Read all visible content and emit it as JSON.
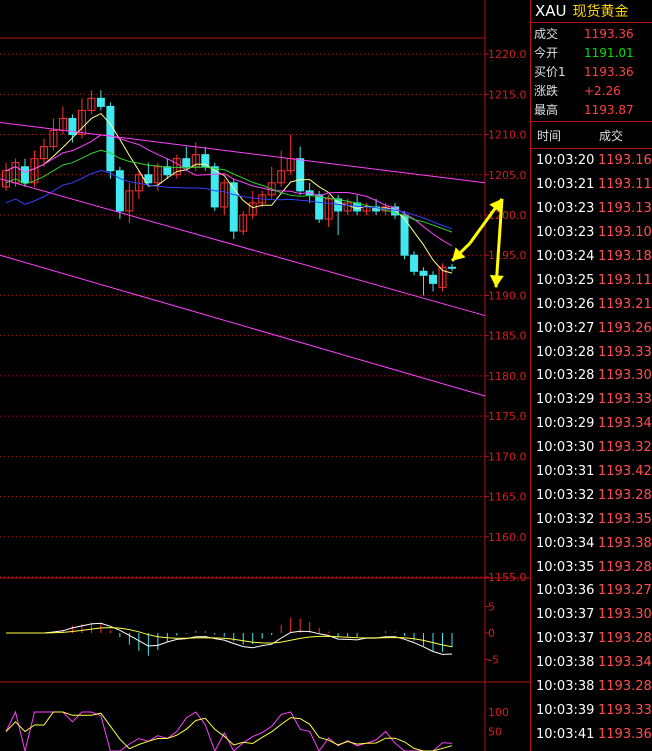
{
  "header": {
    "symbol": "XAU",
    "name": "现货黄金"
  },
  "quote": [
    {
      "label": "成交",
      "value": "1193.36",
      "color": "red"
    },
    {
      "label": "今开",
      "value": "1191.01",
      "color": "green"
    },
    {
      "label": "买价1",
      "value": "1193.36",
      "color": "red"
    },
    {
      "label": "涨跌",
      "value": "+2.26",
      "color": "red"
    },
    {
      "label": "最高",
      "value": "1193.87",
      "color": "red"
    }
  ],
  "ticks_header": {
    "time": "时间",
    "price": "成交"
  },
  "ticks": [
    {
      "time": "10:03:20",
      "price": "1193.16"
    },
    {
      "time": "10:03:21",
      "price": "1193.11"
    },
    {
      "time": "10:03:23",
      "price": "1193.13"
    },
    {
      "time": "10:03:23",
      "price": "1193.10"
    },
    {
      "time": "10:03:24",
      "price": "1193.18"
    },
    {
      "time": "10:03:25",
      "price": "1193.11"
    },
    {
      "time": "10:03:26",
      "price": "1193.21"
    },
    {
      "time": "10:03:27",
      "price": "1193.26"
    },
    {
      "time": "10:03:28",
      "price": "1193.33"
    },
    {
      "time": "10:03:28",
      "price": "1193.30"
    },
    {
      "time": "10:03:29",
      "price": "1193.33"
    },
    {
      "time": "10:03:29",
      "price": "1193.34"
    },
    {
      "time": "10:03:30",
      "price": "1193.32"
    },
    {
      "time": "10:03:31",
      "price": "1193.42"
    },
    {
      "time": "10:03:32",
      "price": "1193.28"
    },
    {
      "time": "10:03:32",
      "price": "1193.35"
    },
    {
      "time": "10:03:34",
      "price": "1193.38"
    },
    {
      "time": "10:03:35",
      "price": "1193.28"
    },
    {
      "time": "10:03:36",
      "price": "1193.27"
    },
    {
      "time": "10:03:37",
      "price": "1193.30"
    },
    {
      "time": "10:03:37",
      "price": "1193.28"
    },
    {
      "time": "10:03:38",
      "price": "1193.34"
    },
    {
      "time": "10:03:38",
      "price": "1193.28"
    },
    {
      "time": "10:03:39",
      "price": "1193.33"
    },
    {
      "time": "10:03:41",
      "price": "1193.36"
    }
  ],
  "chart_data": {
    "type": "candlestick",
    "y_ticks": [
      "1220.0",
      "1215.0",
      "1210.0",
      "1205.0",
      "1200.0",
      "1195.0",
      "1190.0",
      "1185.0",
      "1180.0",
      "1175.0",
      "1170.0",
      "1165.0",
      "1160.0",
      "1155.0"
    ],
    "ylim": [
      1155,
      1222
    ],
    "macd_ticks": [
      "5",
      "0",
      "-5"
    ],
    "kdj_ticks": [
      "100",
      "50"
    ],
    "colors": {
      "up": "#ff3030",
      "down": "#40e8f0",
      "grid": "#b41414",
      "ma5": "#ffff88",
      "ma10": "#ff40ff",
      "ma20": "#30d030",
      "ma60": "#3040ff",
      "channel": "#ff40ff",
      "arrow": "#ffff00"
    },
    "candles": [
      {
        "o": 1203.5,
        "c": 1205.5,
        "h": 1206.5,
        "l": 1203.0
      },
      {
        "o": 1204.0,
        "c": 1206.5,
        "h": 1207.0,
        "l": 1203.5
      },
      {
        "o": 1206.0,
        "c": 1204.0,
        "h": 1207.0,
        "l": 1203.5
      },
      {
        "o": 1204.0,
        "c": 1207.0,
        "h": 1208.0,
        "l": 1203.5
      },
      {
        "o": 1207.0,
        "c": 1208.5,
        "h": 1209.5,
        "l": 1206.0
      },
      {
        "o": 1208.5,
        "c": 1210.5,
        "h": 1212.0,
        "l": 1208.0
      },
      {
        "o": 1210.5,
        "c": 1212.0,
        "h": 1213.5,
        "l": 1210.0
      },
      {
        "o": 1212.0,
        "c": 1210.0,
        "h": 1212.5,
        "l": 1209.0
      },
      {
        "o": 1210.0,
        "c": 1213.0,
        "h": 1214.5,
        "l": 1209.5
      },
      {
        "o": 1213.0,
        "c": 1214.5,
        "h": 1215.5,
        "l": 1212.5
      },
      {
        "o": 1214.5,
        "c": 1213.5,
        "h": 1215.5,
        "l": 1213.0
      },
      {
        "o": 1213.5,
        "c": 1205.5,
        "h": 1214.0,
        "l": 1204.5
      },
      {
        "o": 1205.5,
        "c": 1200.5,
        "h": 1206.0,
        "l": 1199.5
      },
      {
        "o": 1200.5,
        "c": 1203.0,
        "h": 1204.0,
        "l": 1199.0
      },
      {
        "o": 1203.0,
        "c": 1205.0,
        "h": 1205.5,
        "l": 1202.0
      },
      {
        "o": 1205.0,
        "c": 1204.0,
        "h": 1206.5,
        "l": 1203.5
      },
      {
        "o": 1204.0,
        "c": 1206.0,
        "h": 1206.5,
        "l": 1203.0
      },
      {
        "o": 1206.0,
        "c": 1205.0,
        "h": 1207.0,
        "l": 1204.5
      },
      {
        "o": 1205.0,
        "c": 1207.0,
        "h": 1207.5,
        "l": 1204.5
      },
      {
        "o": 1207.0,
        "c": 1206.0,
        "h": 1208.5,
        "l": 1205.5
      },
      {
        "o": 1206.0,
        "c": 1207.5,
        "h": 1209.0,
        "l": 1205.5
      },
      {
        "o": 1207.5,
        "c": 1206.0,
        "h": 1208.5,
        "l": 1205.5
      },
      {
        "o": 1206.0,
        "c": 1201.0,
        "h": 1206.5,
        "l": 1200.5
      },
      {
        "o": 1201.0,
        "c": 1204.0,
        "h": 1204.5,
        "l": 1200.0
      },
      {
        "o": 1204.0,
        "c": 1198.0,
        "h": 1204.5,
        "l": 1197.0
      },
      {
        "o": 1198.0,
        "c": 1200.0,
        "h": 1200.5,
        "l": 1197.5
      },
      {
        "o": 1200.0,
        "c": 1201.5,
        "h": 1203.0,
        "l": 1199.5
      },
      {
        "o": 1201.5,
        "c": 1202.5,
        "h": 1203.0,
        "l": 1201.0
      },
      {
        "o": 1202.5,
        "c": 1204.0,
        "h": 1206.0,
        "l": 1202.0
      },
      {
        "o": 1204.0,
        "c": 1205.5,
        "h": 1208.0,
        "l": 1203.5
      },
      {
        "o": 1205.5,
        "c": 1207.0,
        "h": 1210.0,
        "l": 1205.0
      },
      {
        "o": 1207.0,
        "c": 1203.0,
        "h": 1208.5,
        "l": 1202.5
      },
      {
        "o": 1203.0,
        "c": 1202.5,
        "h": 1204.0,
        "l": 1201.5
      },
      {
        "o": 1202.5,
        "c": 1199.5,
        "h": 1203.0,
        "l": 1199.0
      },
      {
        "o": 1199.5,
        "c": 1202.0,
        "h": 1202.5,
        "l": 1198.5
      },
      {
        "o": 1202.0,
        "c": 1200.5,
        "h": 1202.5,
        "l": 1197.5
      },
      {
        "o": 1200.5,
        "c": 1201.5,
        "h": 1202.0,
        "l": 1200.0
      },
      {
        "o": 1201.5,
        "c": 1200.5,
        "h": 1202.5,
        "l": 1200.0
      },
      {
        "o": 1200.5,
        "c": 1201.0,
        "h": 1201.5,
        "l": 1200.0
      },
      {
        "o": 1201.0,
        "c": 1200.5,
        "h": 1202.0,
        "l": 1200.0
      },
      {
        "o": 1200.5,
        "c": 1201.0,
        "h": 1201.5,
        "l": 1200.0
      },
      {
        "o": 1201.0,
        "c": 1200.0,
        "h": 1201.5,
        "l": 1199.5
      },
      {
        "o": 1200.0,
        "c": 1195.0,
        "h": 1200.5,
        "l": 1194.5
      },
      {
        "o": 1195.0,
        "c": 1193.0,
        "h": 1195.5,
        "l": 1192.5
      },
      {
        "o": 1193.0,
        "c": 1192.5,
        "h": 1193.5,
        "l": 1190.0
      },
      {
        "o": 1192.5,
        "c": 1191.5,
        "h": 1193.0,
        "l": 1190.5
      },
      {
        "o": 1191.0,
        "c": 1193.5,
        "h": 1194.0,
        "l": 1190.5
      },
      {
        "o": 1193.5,
        "c": 1193.4,
        "h": 1193.9,
        "l": 1193.0
      }
    ],
    "channel_lines": [
      {
        "x1": 0,
        "y1": 1211.5,
        "x2": 485,
        "y2": 1204.0
      },
      {
        "x1": 0,
        "y1": 1204.5,
        "x2": 485,
        "y2": 1187.5
      },
      {
        "x1": 0,
        "y1": 1195.0,
        "x2": 485,
        "y2": 1177.5
      }
    ],
    "arrows": [
      {
        "x1": 470,
        "y1": 1196.5,
        "x2": 465,
        "y2": 1194.5
      },
      {
        "x1": 470,
        "y1": 1196.5,
        "x2": 502,
        "y2": 1202.0
      },
      {
        "x1": 502,
        "y1": 1202.0,
        "x2": 496,
        "y2": 1191.0
      },
      {
        "x1": 470,
        "y1": 1196.5,
        "x2": 452,
        "y2": 1194.3
      }
    ]
  }
}
